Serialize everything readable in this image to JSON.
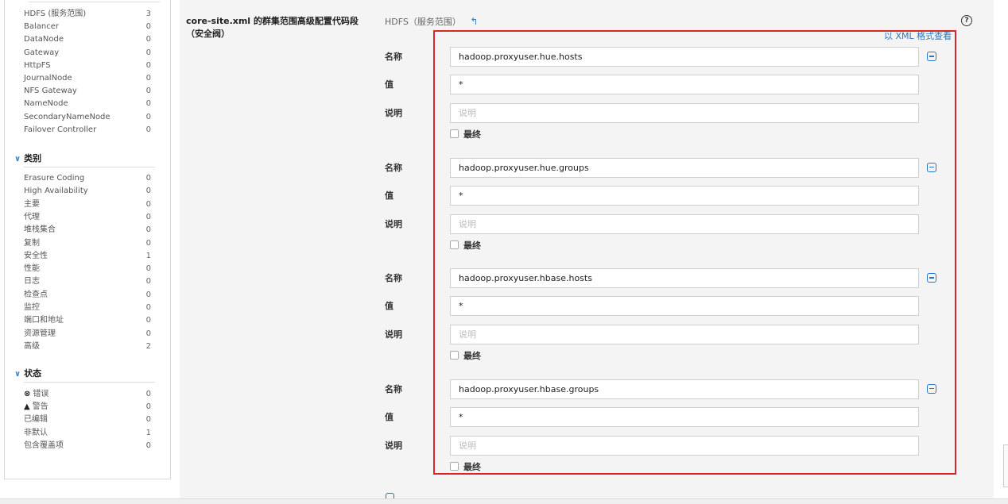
{
  "sidebar": {
    "scope_items": [
      {
        "label": "HDFS (服务范围)",
        "count": "3"
      },
      {
        "label": "Balancer",
        "count": "0"
      },
      {
        "label": "DataNode",
        "count": "0"
      },
      {
        "label": "Gateway",
        "count": "0"
      },
      {
        "label": "HttpFS",
        "count": "0"
      },
      {
        "label": "JournalNode",
        "count": "0"
      },
      {
        "label": "NFS Gateway",
        "count": "0"
      },
      {
        "label": "NameNode",
        "count": "0"
      },
      {
        "label": "SecondaryNameNode",
        "count": "0"
      },
      {
        "label": "Failover Controller",
        "count": "0"
      }
    ],
    "category_heading": "类别",
    "category_items": [
      {
        "label": "Erasure Coding",
        "count": "0"
      },
      {
        "label": "High Availability",
        "count": "0"
      },
      {
        "label": "主要",
        "count": "0"
      },
      {
        "label": "代理",
        "count": "0"
      },
      {
        "label": "堆栈集合",
        "count": "0"
      },
      {
        "label": "复制",
        "count": "0"
      },
      {
        "label": "安全性",
        "count": "1"
      },
      {
        "label": "性能",
        "count": "0"
      },
      {
        "label": "日志",
        "count": "0"
      },
      {
        "label": "检查点",
        "count": "0"
      },
      {
        "label": "监控",
        "count": "0"
      },
      {
        "label": "端口和地址",
        "count": "0"
      },
      {
        "label": "资源管理",
        "count": "0"
      },
      {
        "label": "高级",
        "count": "2"
      }
    ],
    "status_heading": "状态",
    "status_items": [
      {
        "label": "错误",
        "count": "0",
        "icon": "error-icon"
      },
      {
        "label": "警告",
        "count": "0",
        "icon": "warning-icon"
      },
      {
        "label": "已编辑",
        "count": "0"
      },
      {
        "label": "非默认",
        "count": "1"
      },
      {
        "label": "包含覆盖项",
        "count": "0"
      }
    ]
  },
  "property": {
    "title": "core-site.xml 的群集范围高级配置代码段（安全阀）",
    "scope": "HDFS（服务范围）",
    "xml_view_link": "以 XML 格式查看",
    "labels": {
      "name": "名称",
      "value": "值",
      "description": "说明",
      "final": "最终",
      "description_placeholder": "说明"
    },
    "entries": [
      {
        "name": "hadoop.proxyuser.hue.hosts",
        "value": "*"
      },
      {
        "name": "hadoop.proxyuser.hue.groups",
        "value": "*"
      },
      {
        "name": "hadoop.proxyuser.hbase.hosts",
        "value": "*"
      },
      {
        "name": "hadoop.proxyuser.hbase.groups",
        "value": "*"
      }
    ]
  }
}
